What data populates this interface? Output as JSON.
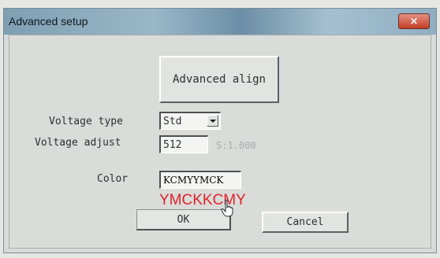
{
  "window": {
    "title": "Advanced setup",
    "close_label": "×"
  },
  "dialog": {
    "advanced_align_label": "Advanced align",
    "voltage_type_label": "Voltage type",
    "voltage_type_value": "Std",
    "voltage_adjust_label": "Voltage adjust",
    "voltage_adjust_value": "512",
    "voltage_scale_text": "S:1.000",
    "color_label": "Color",
    "color_value": "KCMYYMCK",
    "color_overlay_text": "YMCKKCMY",
    "ok_label": "OK",
    "cancel_label": "Cancel"
  },
  "colors": {
    "title_bar": "#8fadc1",
    "close_button": "#c9483a",
    "dialog_background": "#d9dcd9",
    "overlay_text": "#e0222a"
  },
  "icons": {
    "close": "close-icon",
    "dropdown": "chevron-down-icon",
    "cursor": "hand-pointer-icon"
  }
}
